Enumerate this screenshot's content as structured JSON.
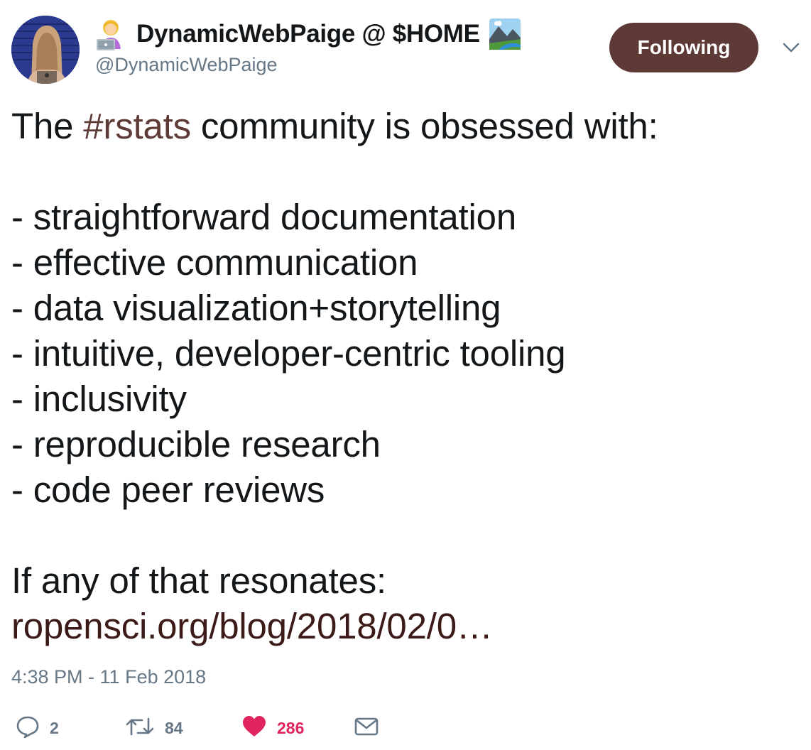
{
  "author": {
    "display_name": "DynamicWebPaige @ $HOME",
    "handle": "@DynamicWebPaige"
  },
  "follow_button": {
    "label": "Following"
  },
  "tweet": {
    "intro_prefix": "The ",
    "hashtag": "#rstats",
    "intro_suffix": " community is obsessed with:",
    "items": [
      "- straightforward documentation",
      "- effective communication",
      "- data visualization+storytelling",
      "- intuitive, developer-centric tooling",
      "- inclusivity",
      "- reproducible research",
      "- code peer reviews"
    ],
    "closing": "If any of that resonates:",
    "link": "ropensci.org/blog/2018/02/0",
    "link_ellipsis": "…"
  },
  "timestamp": "4:38 PM - 11 Feb 2018",
  "actions": {
    "replies": "2",
    "retweets": "84",
    "likes": "286"
  },
  "icons": {
    "reply": "speech-bubble-icon",
    "retweet": "retweet-icon",
    "like": "heart-icon",
    "dm": "envelope-icon",
    "caret": "chevron-down-icon"
  },
  "colors": {
    "accent": "#5e3a36",
    "text": "#14171a",
    "muted": "#657786",
    "like": "#e0245e"
  }
}
